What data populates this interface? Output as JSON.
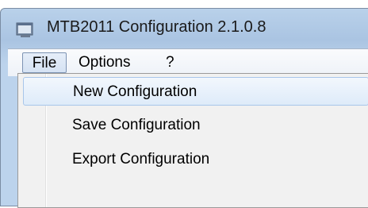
{
  "window": {
    "title": "MTB2011 Configuration 2.1.0.8",
    "icon": "app-window-icon"
  },
  "menubar": {
    "items": [
      "File",
      "Options",
      "?"
    ],
    "active": "File"
  },
  "file_menu": {
    "items": [
      "New Configuration",
      "Save Configuration",
      "Export Configuration"
    ],
    "highlighted": "New Configuration"
  },
  "colors": {
    "titlebar": "#b9d1ea",
    "menu_highlight": "#deebf9",
    "menu_highlight_border": "#a8c6ea",
    "dropdown_bg": "#f1f1f1"
  }
}
